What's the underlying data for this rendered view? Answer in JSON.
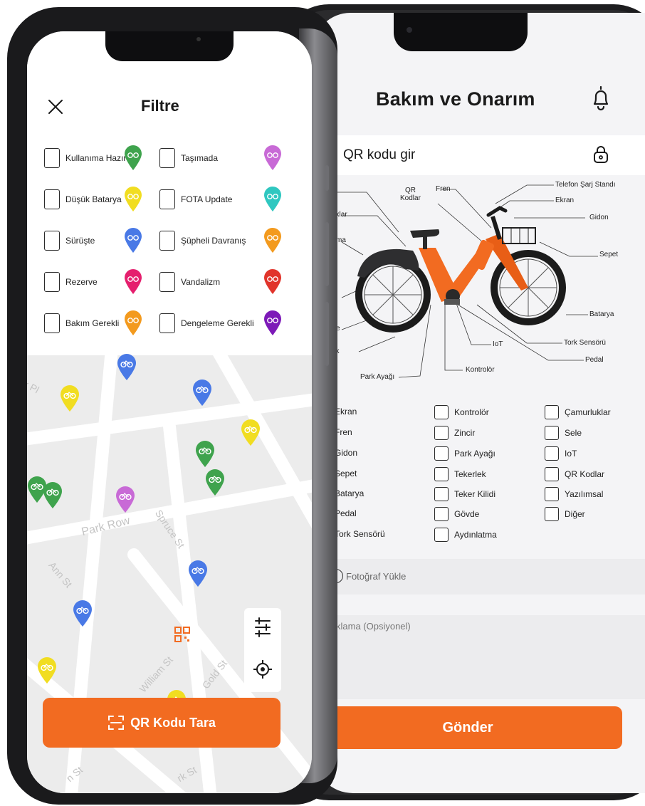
{
  "left_screen": {
    "title": "Filtre",
    "filters": [
      {
        "label": "Kullanıma Hazır",
        "pin_color": "#3fa34d",
        "icon": "bike-icon"
      },
      {
        "label": "Taşımada",
        "pin_color": "#c86ad6",
        "icon": "bus-icon"
      },
      {
        "label": "Düşük Batarya",
        "pin_color": "#f1dd21",
        "icon": "bike-icon"
      },
      {
        "label": "FOTA Update",
        "pin_color": "#2fc7c0",
        "icon": "cloud-upload-icon"
      },
      {
        "label": "Sürüşte",
        "pin_color": "#4979e6",
        "icon": "bike-icon"
      },
      {
        "label": "Şüpheli Davranış",
        "pin_color": "#f39a1e",
        "icon": "alert-face-icon"
      },
      {
        "label": "Rezerve",
        "pin_color": "#e51f6e",
        "icon": "calendar-check-icon"
      },
      {
        "label": "Vandalizm",
        "pin_color": "#e1342b",
        "icon": "skull-icon"
      },
      {
        "label": "Bakım Gerekli",
        "pin_color": "#f39a1e",
        "icon": "wrench-icon"
      },
      {
        "label": "Dengeleme Gerekli",
        "pin_color": "#7d1ab8",
        "icon": "balance-icon"
      }
    ],
    "map_streets": [
      "k Pl",
      "Park Row",
      "Spruce St",
      "Ann St",
      "William St",
      "Gold St",
      "n St",
      "rk St"
    ],
    "scan_button": "QR Kodu Tara"
  },
  "right_screen": {
    "title": "Bakım ve Onarım",
    "qr_input": "QR kodu gir",
    "diagram_labels": {
      "qr": "QR\nKodlar",
      "fren": "Fren",
      "telefon": "Telefon Şarj Standı",
      "ekran": "Ekran",
      "gidon": "Gidon",
      "sepet": "Sepet",
      "batarya": "Batarya",
      "tork": "Tork Sensörü",
      "pedal": "Pedal",
      "iot": "IoT",
      "kontrolor": "Kontrolör",
      "park": "Park Ayağı",
      "cut_e1": "e",
      "cut_luklar": "uklar",
      "cut_ma": "ma",
      "cut_e2": "e",
      "cut_ek": "ek"
    },
    "parts_col1": [
      "Ekran",
      "Fren",
      "Gidon",
      "Sepet",
      "Batarya",
      "Pedal",
      "Tork Sensörü"
    ],
    "parts_col2": [
      "Kontrolör",
      "Zincir",
      "Park Ayağı",
      "Tekerlek",
      "Teker Kilidi",
      "Gövde",
      "Aydınlatma"
    ],
    "parts_col3": [
      "Çamurluklar",
      "Sele",
      "IoT",
      "QR Kodlar",
      "Yazılımsal",
      "Diğer"
    ],
    "photo_upload": "Fotoğraf Yükle",
    "description_placeholder": "klama (Opsiyonel)",
    "submit": "Gönder"
  },
  "colors": {
    "accent": "#f26b21",
    "bike_body": "#f26b21",
    "frame": "#1d1d1f"
  }
}
